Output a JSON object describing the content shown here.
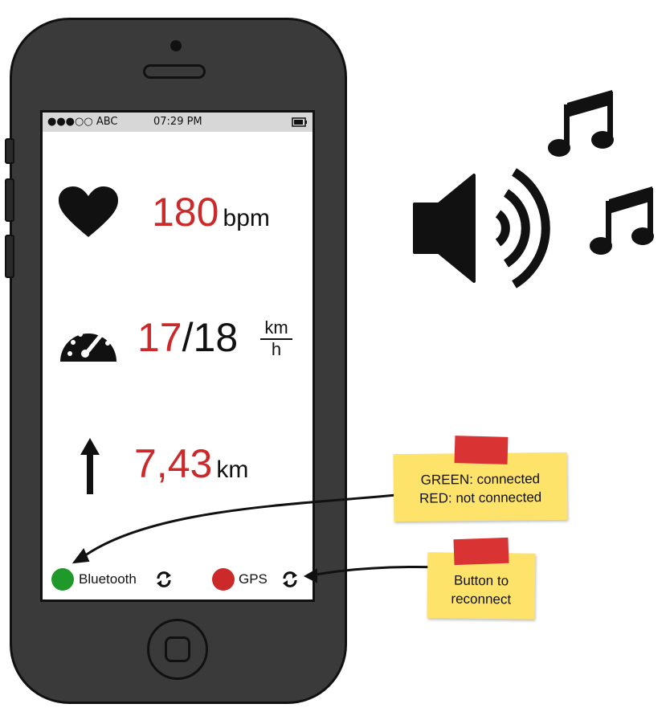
{
  "status_bar": {
    "carrier": "●●●○○ ABC",
    "time": "07:29 PM",
    "battery_icon": "battery-icon"
  },
  "heart_rate": {
    "value": "180",
    "unit": "bpm",
    "icon": "heart-icon"
  },
  "speed": {
    "current": "17",
    "separator": "/",
    "target": "18",
    "unit_top": "km",
    "unit_bottom": "h",
    "icon": "speedometer-icon"
  },
  "distance": {
    "value": "7,43",
    "unit": "km",
    "icon": "arrow-up-icon"
  },
  "connections": [
    {
      "label": "Bluetooth",
      "status_color": "#1f9a2a",
      "icon": "reconnect-icon"
    },
    {
      "label": "GPS",
      "status_color": "#cc2a2a",
      "icon": "reconnect-icon"
    }
  ],
  "notes": {
    "legend": {
      "line1": "GREEN: connected",
      "line2": "RED: not connected"
    },
    "button": {
      "line1": "Button to",
      "line2": "reconnect"
    }
  },
  "audio": {
    "icons": [
      "speaker-icon",
      "music-note-icon",
      "music-note-icon"
    ]
  },
  "colors": {
    "value_red": "#cc2a2a",
    "connected_green": "#1f9a2a",
    "note_yellow": "#fde36a"
  }
}
